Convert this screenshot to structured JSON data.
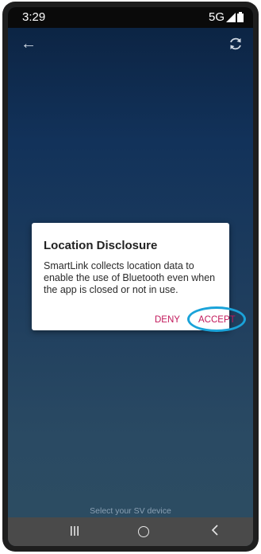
{
  "status_bar": {
    "time": "3:29",
    "network": "5G"
  },
  "top_bar": {
    "back_icon": "arrow-left-icon",
    "refresh_icon": "refresh-icon"
  },
  "dialog": {
    "title": "Location Disclosure",
    "body": "SmartLink collects location data to enable the use of Bluetooth even when the app is closed or not in use.",
    "deny_label": "DENY",
    "accept_label": "ACCEPT",
    "accent_color": "#c2185b",
    "highlight_color": "#1aa3d9"
  },
  "main": {
    "hint_text": "Select your SV device"
  },
  "nav_bar": {
    "recent": "recent-apps-icon",
    "home": "home-icon",
    "back": "back-icon"
  }
}
